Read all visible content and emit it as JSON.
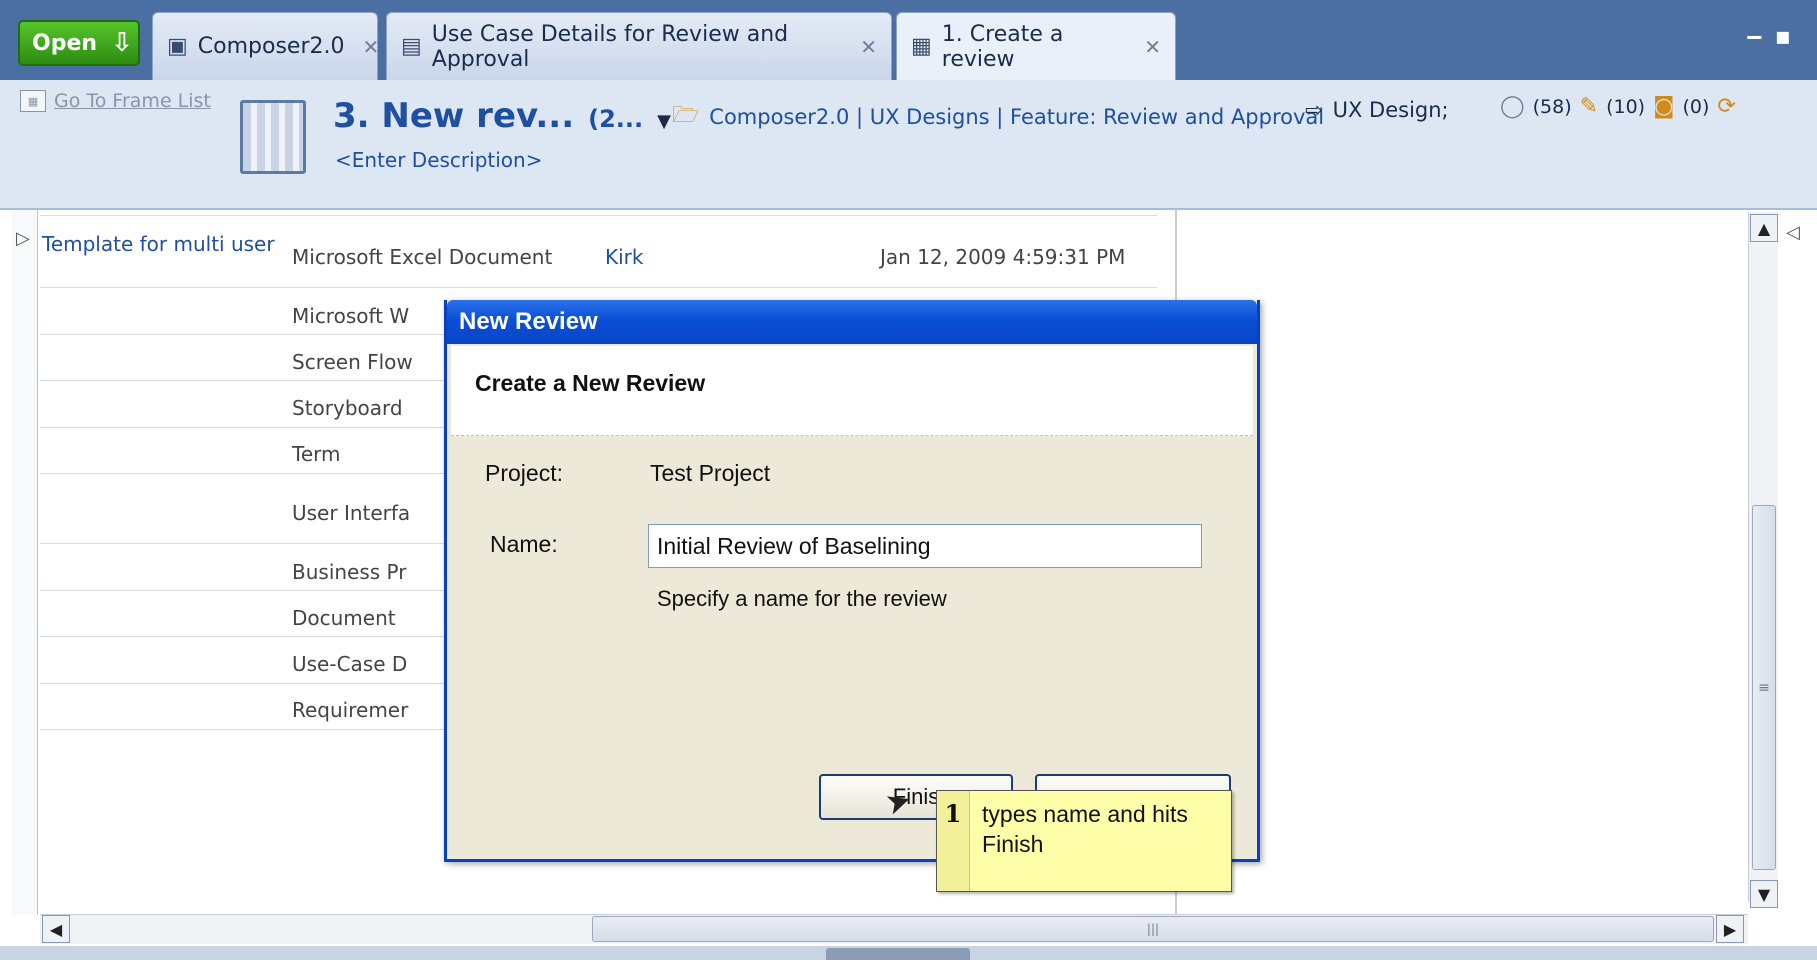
{
  "tabs": {
    "open_label": "Open",
    "items": [
      {
        "label": "Composer2.0"
      },
      {
        "label": "Use Case Details for Review and Approval"
      },
      {
        "label": "1. Create a review"
      }
    ]
  },
  "header": {
    "goto_label": "Go To Frame List",
    "frame_title": "3. New rev...",
    "frame_count": "(2...",
    "description": "<Enter Description>",
    "breadcrumb": "Composer2.0 | UX Designs | Feature: Review and Approval",
    "ux_design": "UX Design;",
    "comments_count": "(58)",
    "edits_count": "(10)",
    "notes_count": "(0)"
  },
  "list": {
    "template_link": "Template for multi user",
    "rows": [
      {
        "type": "Microsoft Excel Document",
        "owner": "Kirk",
        "date": "Jan 12, 2009 4:59:31 PM"
      },
      {
        "type": "Microsoft W"
      },
      {
        "type": "Screen Flow"
      },
      {
        "type": "Storyboard"
      },
      {
        "type": "Term"
      },
      {
        "type": "User Interfa"
      },
      {
        "type": "Business Pr"
      },
      {
        "type": "Document"
      },
      {
        "type": "Use-Case D"
      },
      {
        "type": "Requiremer"
      }
    ]
  },
  "dialog": {
    "title": "New Review",
    "heading": "Create a New Review",
    "project_label": "Project:",
    "project_value": "Test Project",
    "name_label": "Name:",
    "name_value": "Initial Review of Baselining",
    "hint": "Specify a name for the review",
    "finish_label": "Finis",
    "cancel_label": ""
  },
  "callout": {
    "number": "1",
    "text": "types name and hits Finish"
  },
  "colors": {
    "tabbar_bg": "#4b6ea3",
    "dialog_titlebar": "#0b4fd6",
    "link_blue": "#1e4fa0",
    "callout_bg": "#ffffaa"
  }
}
